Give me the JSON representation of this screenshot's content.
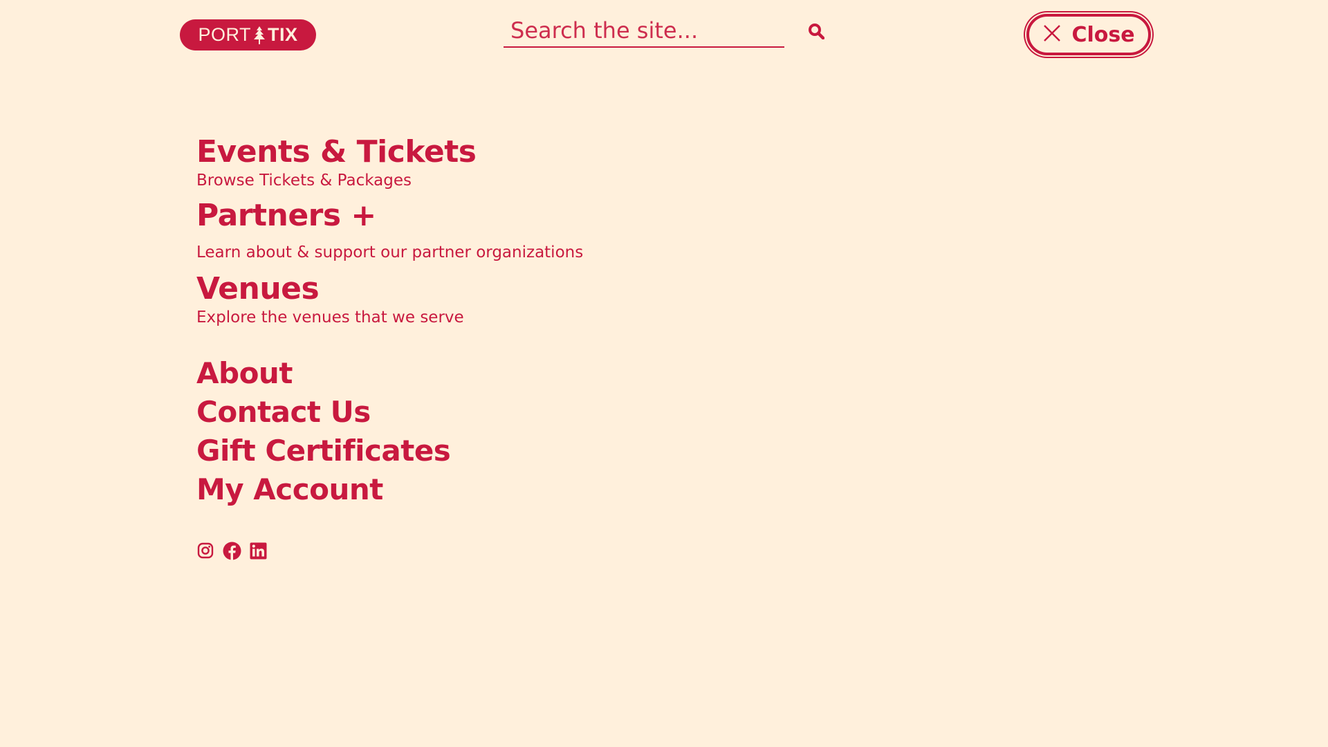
{
  "header": {
    "logo": {
      "part1": "PORT",
      "part2": "TIX"
    },
    "search": {
      "placeholder": "Search the site..."
    },
    "close_label": "Close"
  },
  "menu": {
    "primary": [
      {
        "title": "Events & Tickets",
        "subtitle": "Browse Tickets & Packages"
      },
      {
        "title": "Partners +",
        "subtitle": "Learn about & support our partner organizations"
      },
      {
        "title": "Venues",
        "subtitle": "Explore the venues that we serve"
      }
    ],
    "secondary": [
      {
        "title": "About"
      },
      {
        "title": "Contact Us"
      },
      {
        "title": "Gift Certificates"
      },
      {
        "title": "My Account"
      }
    ]
  },
  "social": {
    "icons": [
      "instagram-icon",
      "facebook-icon",
      "linkedin-icon"
    ]
  },
  "colors": {
    "background": "#fff0dc",
    "brand": "#c8193f"
  }
}
